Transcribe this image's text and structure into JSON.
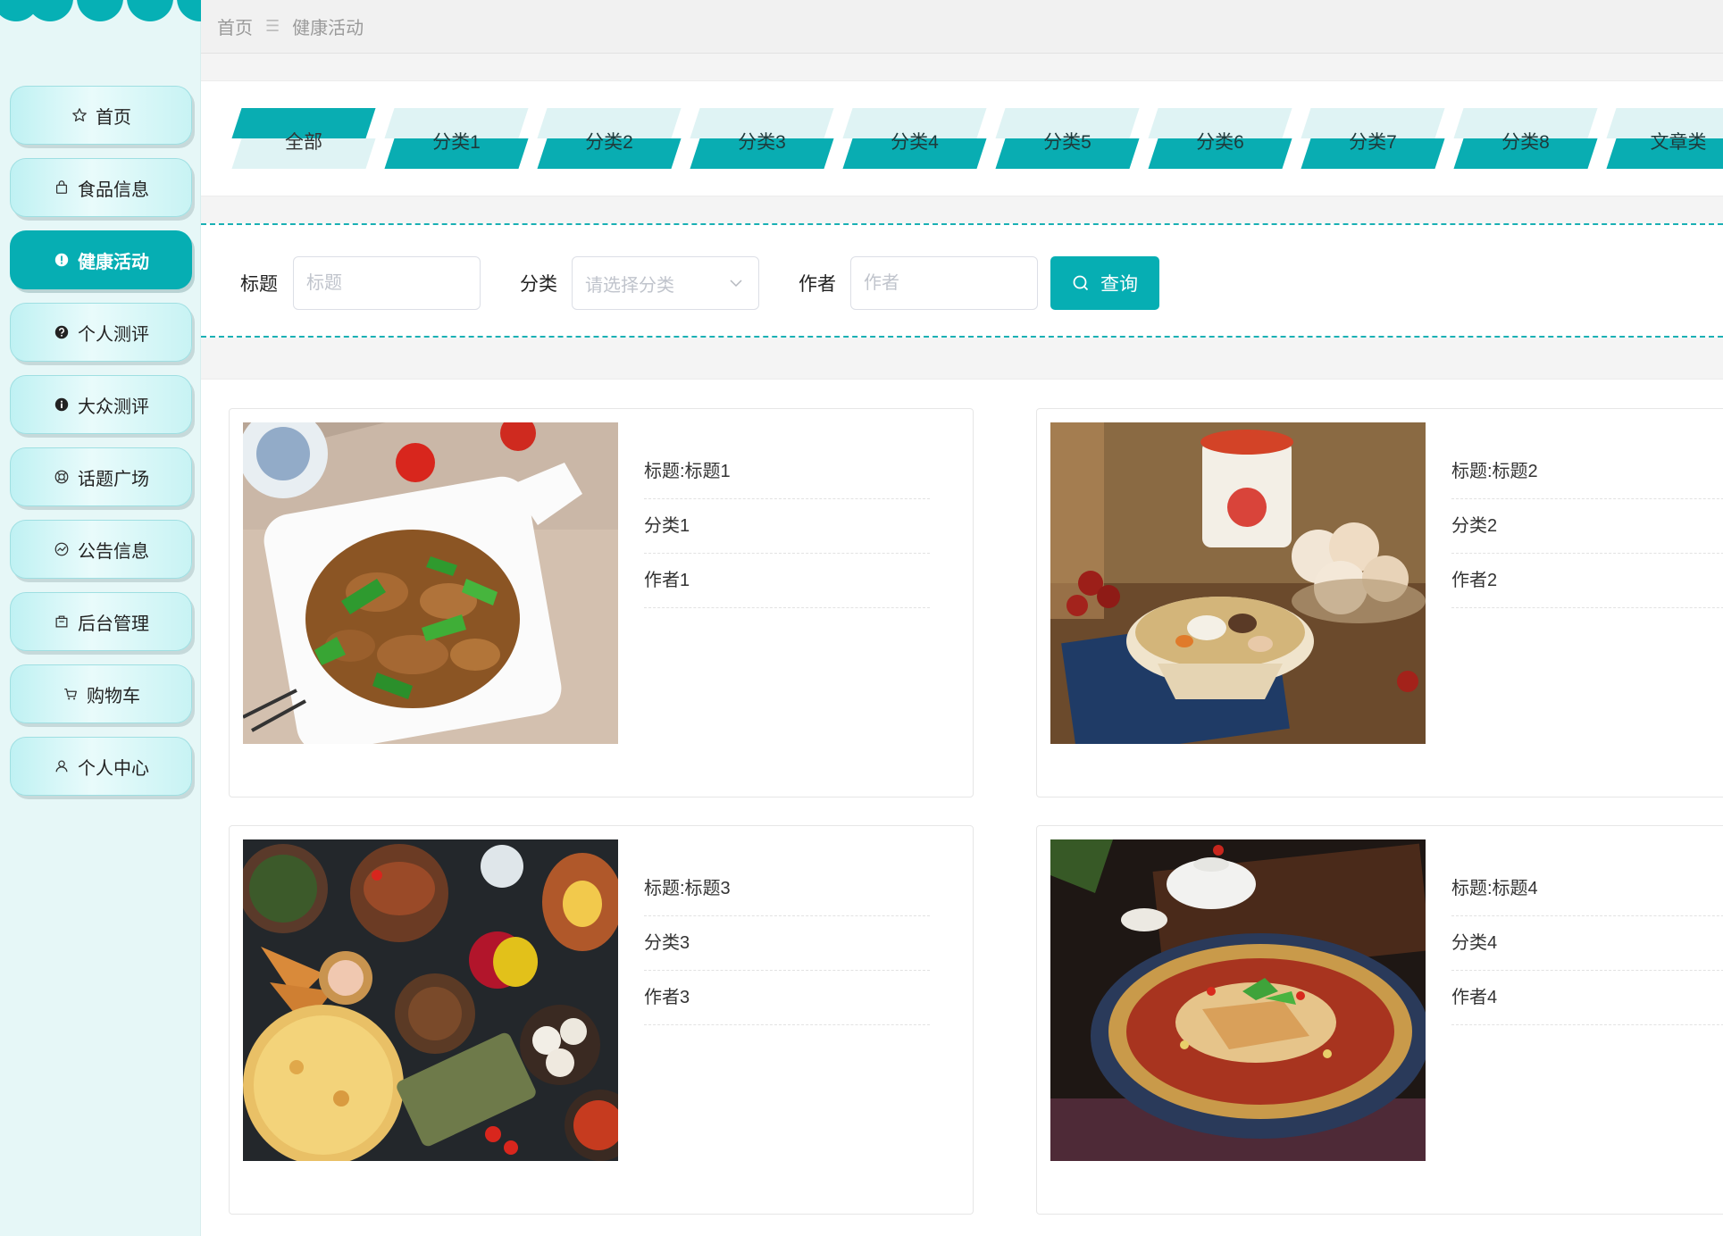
{
  "colors": {
    "accent": "#06aeb3",
    "sidebar_bg": "#e6f7f7"
  },
  "sidebar": {
    "items": [
      {
        "label": "首页",
        "icon": "star-icon",
        "active": false
      },
      {
        "label": "食品信息",
        "icon": "bag-icon",
        "active": false
      },
      {
        "label": "健康活动",
        "icon": "alert-circle-icon",
        "active": true
      },
      {
        "label": "个人测评",
        "icon": "question-circle-icon",
        "active": false
      },
      {
        "label": "大众测评",
        "icon": "info-circle-icon",
        "active": false
      },
      {
        "label": "话题广场",
        "icon": "lifebuoy-icon",
        "active": false
      },
      {
        "label": "公告信息",
        "icon": "chart-circle-icon",
        "active": false
      },
      {
        "label": "后台管理",
        "icon": "box-icon",
        "active": false
      },
      {
        "label": "购物车",
        "icon": "cart-icon",
        "active": false
      },
      {
        "label": "个人中心",
        "icon": "user-icon",
        "active": false
      }
    ]
  },
  "breadcrumb": {
    "home": "首页",
    "separator": "☰",
    "current": "健康活动"
  },
  "tabs": [
    {
      "label": "全部",
      "active": true
    },
    {
      "label": "分类1",
      "active": false
    },
    {
      "label": "分类2",
      "active": false
    },
    {
      "label": "分类3",
      "active": false
    },
    {
      "label": "分类4",
      "active": false
    },
    {
      "label": "分类5",
      "active": false
    },
    {
      "label": "分类6",
      "active": false
    },
    {
      "label": "分类7",
      "active": false
    },
    {
      "label": "分类8",
      "active": false
    },
    {
      "label": "文章类",
      "active": false
    }
  ],
  "search": {
    "title_label": "标题",
    "title_placeholder": "标题",
    "category_label": "分类",
    "category_placeholder": "请选择分类",
    "author_label": "作者",
    "author_placeholder": "作者",
    "button_label": "查询"
  },
  "cards": [
    {
      "title": "标题:标题1",
      "category": "分类1",
      "author": "作者1",
      "image": "stir-fried-pork-peppers"
    },
    {
      "title": "标题:标题2",
      "category": "分类2",
      "author": "作者2",
      "image": "soup-bowl"
    },
    {
      "title": "标题:标题3",
      "category": "分类3",
      "author": "作者3",
      "image": "feast-table"
    },
    {
      "title": "标题:标题4",
      "category": "分类4",
      "author": "作者4",
      "image": "chili-dish-teapot"
    }
  ]
}
